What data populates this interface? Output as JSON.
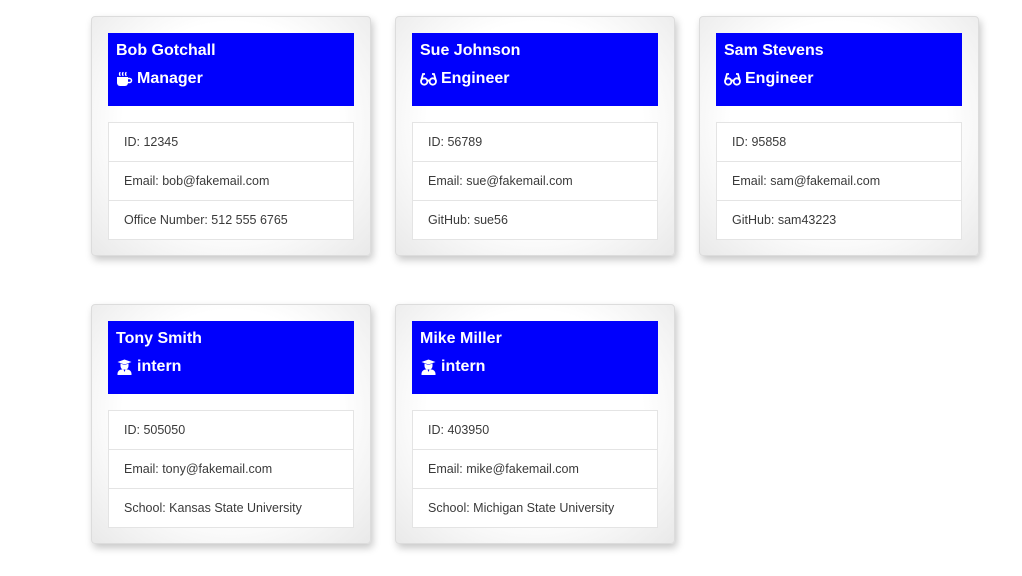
{
  "employees": [
    {
      "name": "Bob Gotchall",
      "role": "Manager",
      "role_icon": "coffee-mug-icon",
      "id_text": "ID: 12345",
      "email_text": "Email: bob@fakemail.com",
      "extra_text": "Office Number: 512 555 6765"
    },
    {
      "name": "Sue Johnson",
      "role": "Engineer",
      "role_icon": "glasses-icon",
      "id_text": "ID: 56789",
      "email_text": "Email: sue@fakemail.com",
      "extra_text": "GitHub: sue56"
    },
    {
      "name": "Sam Stevens",
      "role": "Engineer",
      "role_icon": "glasses-icon",
      "id_text": "ID: 95858",
      "email_text": "Email: sam@fakemail.com",
      "extra_text": "GitHub: sam43223"
    },
    {
      "name": "Tony Smith",
      "role": "intern",
      "role_icon": "graduate-icon",
      "id_text": "ID: 505050",
      "email_text": "Email: tony@fakemail.com",
      "extra_text": "School: Kansas State University"
    },
    {
      "name": "Mike Miller",
      "role": "intern",
      "role_icon": "graduate-icon",
      "id_text": "ID: 403950",
      "email_text": "Email: mike@fakemail.com",
      "extra_text": "School: Michigan State University"
    }
  ],
  "colors": {
    "header_bg": "#0000fd",
    "header_text": "#ffffff",
    "list_text": "#3a3a3a"
  }
}
